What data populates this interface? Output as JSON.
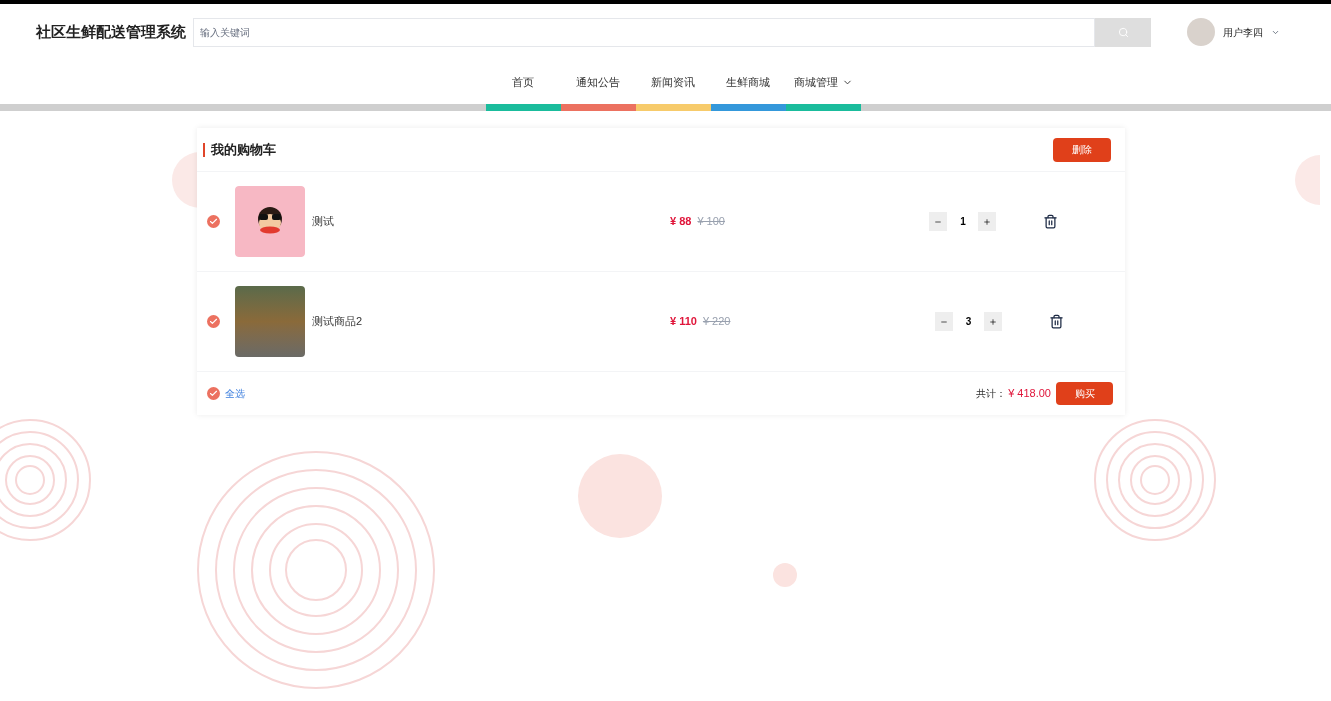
{
  "header": {
    "title": "社区生鲜配送管理系统",
    "search": {
      "placeholder": "输入关键词"
    },
    "user": {
      "name": "用户李四"
    }
  },
  "nav": [
    {
      "label": "首页",
      "color": "#1abc9c",
      "dropdown": false
    },
    {
      "label": "通知公告",
      "color": "#ec7160",
      "dropdown": false
    },
    {
      "label": "新闻资讯",
      "color": "#f7cb6b",
      "dropdown": false
    },
    {
      "label": "生鲜商城",
      "color": "#3498db",
      "dropdown": false
    },
    {
      "label": "商城管理",
      "color": "#1abc9c",
      "dropdown": true
    }
  ],
  "cart": {
    "title": "我的购物车",
    "delete_button": "删除",
    "items": [
      {
        "kind": "illustration",
        "name": "测试",
        "price": "¥ 88",
        "original_price": "¥ 100",
        "quantity": "1",
        "checked": true
      },
      {
        "kind": "photo",
        "name": "测试商品2",
        "price": "¥ 110",
        "original_price": "¥ 220",
        "quantity": "3",
        "checked": true
      }
    ],
    "select_all": {
      "label": "全选",
      "checked": true
    },
    "total_label": "共计：",
    "total": "¥ 418.00",
    "buy_button": "购买"
  }
}
